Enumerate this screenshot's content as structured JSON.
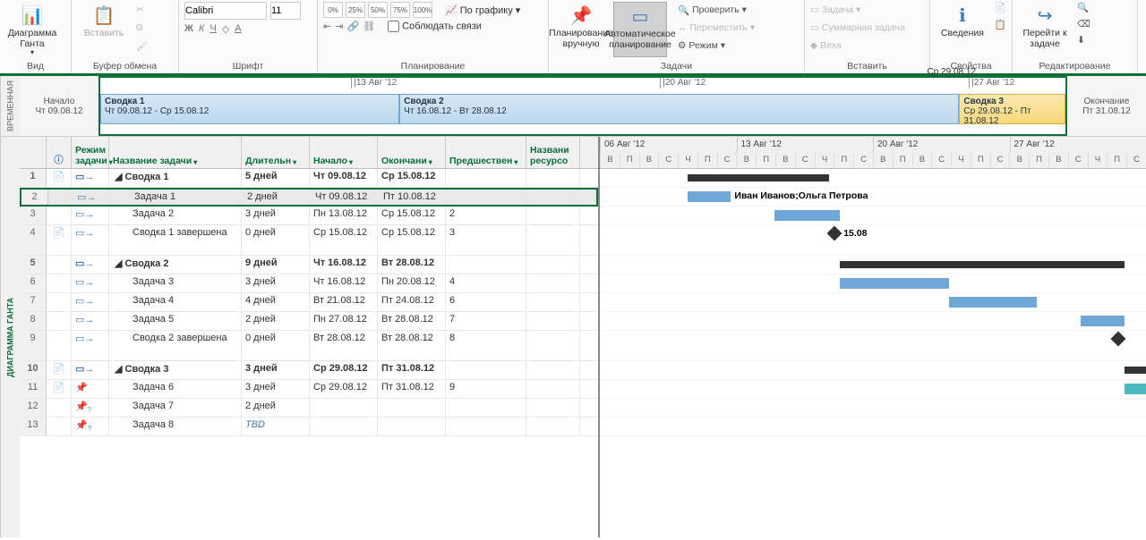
{
  "ribbon": {
    "groups": {
      "view": {
        "title": "Вид",
        "gantt_btn": "Диаграмма Ганта"
      },
      "clipboard": {
        "title": "Буфер обмена",
        "paste": "Вставить",
        "cut": "Вырезать",
        "copy": "Копировать",
        "fmt": "Формат по образцу"
      },
      "font": {
        "title": "Шрифт",
        "name": "Calibri",
        "size": "11"
      },
      "schedule": {
        "title": "Планирование",
        "links": "Соблюдать связи",
        "chart": "По графику",
        "pcts": [
          "0%",
          "25%",
          "50%",
          "75%",
          "100%"
        ]
      },
      "tasks": {
        "title": "Задачи",
        "manual": "Планирование вручную",
        "auto": "Автоматическое планирование",
        "inspect": "Проверить",
        "move": "Переместить",
        "mode": "Режим"
      },
      "insert": {
        "title": "Вставить",
        "task": "Задача",
        "sum": "Суммарная задача",
        "milestone": "Веха"
      },
      "props": {
        "title": "Свойства",
        "info": "Сведения"
      },
      "edit": {
        "title": "Редактирование",
        "goto": "Перейти к задаче"
      }
    }
  },
  "timeline": {
    "side": "ВРЕМЕННАЯ",
    "start_label": "Начало",
    "start_date": "Чт 09.08.12",
    "end_label": "Окончание",
    "end_date": "Пт 31.08.12",
    "ticks": [
      {
        "pos": 26,
        "label": "13 Авг '12"
      },
      {
        "pos": 58,
        "label": "20 Авг '12"
      },
      {
        "pos": 90,
        "label": "27 Авг '12"
      }
    ],
    "current": "Ср 29.08.12",
    "bars": [
      {
        "title": "Сводка 1",
        "dates": "Чт 09.08.12 - Ср 15.08.12",
        "w": 31,
        "cls": ""
      },
      {
        "title": "Сводка 2",
        "dates": "Чт 16.08.12 - Вт 28.08.12",
        "w": 58,
        "cls": ""
      },
      {
        "title": "Сводка 3",
        "dates": "Ср 29.08.12 - Пт 31.08.12",
        "w": 11,
        "cls": "sv3"
      }
    ]
  },
  "table": {
    "side": "ДИАГРАММА ГАНТА",
    "headers": {
      "mode": "Режим задачи",
      "name": "Название задачи",
      "dur": "Длительн",
      "start": "Начало",
      "fin": "Окончани",
      "pred": "Предшествен",
      "res": "Названи ресурсо"
    },
    "rows": [
      {
        "n": 1,
        "i": "note",
        "mode": "auto",
        "name": "Сводка 1",
        "indent": 0,
        "summary": true,
        "dur": "5 дней",
        "start": "Чт 09.08.12",
        "fin": "Ср 15.08.12",
        "pred": "",
        "bold": true
      },
      {
        "n": 2,
        "i": "",
        "mode": "auto",
        "name": "Задача 1",
        "indent": 1,
        "dur": "2 дней",
        "start": "Чт 09.08.12",
        "fin": "Пт 10.08.12",
        "pred": "",
        "sel": true
      },
      {
        "n": 3,
        "i": "",
        "mode": "auto",
        "name": "Задача 2",
        "indent": 1,
        "dur": "3 дней",
        "start": "Пн 13.08.12",
        "fin": "Ср 15.08.12",
        "pred": "2"
      },
      {
        "n": 4,
        "i": "note",
        "mode": "auto",
        "name": "Сводка 1 завершена",
        "indent": 1,
        "dur": "0 дней",
        "start": "Ср 15.08.12",
        "fin": "Ср 15.08.12",
        "pred": "3",
        "tall": true
      },
      {
        "n": 5,
        "i": "",
        "mode": "auto",
        "name": "Сводка 2",
        "indent": 0,
        "summary": true,
        "dur": "9 дней",
        "start": "Чт 16.08.12",
        "fin": "Вт 28.08.12",
        "pred": "",
        "bold": true
      },
      {
        "n": 6,
        "i": "",
        "mode": "auto",
        "name": "Задача 3",
        "indent": 1,
        "dur": "3 дней",
        "start": "Чт 16.08.12",
        "fin": "Пн 20.08.12",
        "pred": "4"
      },
      {
        "n": 7,
        "i": "",
        "mode": "auto",
        "name": "Задача 4",
        "indent": 1,
        "dur": "4 дней",
        "start": "Вт 21.08.12",
        "fin": "Пт 24.08.12",
        "pred": "6"
      },
      {
        "n": 8,
        "i": "",
        "mode": "auto",
        "name": "Задача 5",
        "indent": 1,
        "dur": "2 дней",
        "start": "Пн 27.08.12",
        "fin": "Вт 28.08.12",
        "pred": "7"
      },
      {
        "n": 9,
        "i": "",
        "mode": "auto",
        "name": "Сводка 2 завершена",
        "indent": 1,
        "dur": "0 дней",
        "start": "Вт 28.08.12",
        "fin": "Вт 28.08.12",
        "pred": "8",
        "tall": true
      },
      {
        "n": 10,
        "i": "note",
        "mode": "auto",
        "name": "Сводка 3",
        "indent": 0,
        "summary": true,
        "dur": "3 дней",
        "start": "Ср 29.08.12",
        "fin": "Пт 31.08.12",
        "pred": "",
        "bold": true
      },
      {
        "n": 11,
        "i": "note",
        "mode": "manual",
        "name": "Задача 6",
        "indent": 1,
        "dur": "3 дней",
        "start": "Ср 29.08.12",
        "fin": "Пт 31.08.12",
        "pred": "9"
      },
      {
        "n": 12,
        "i": "",
        "mode": "manual-q",
        "name": "Задача 7",
        "indent": 1,
        "dur": "2 дней",
        "start": "",
        "fin": "",
        "pred": ""
      },
      {
        "n": 13,
        "i": "",
        "mode": "manual-q",
        "name": "Задача 8",
        "indent": 1,
        "dur": "TBD",
        "start": "",
        "fin": "",
        "pred": "",
        "tbd": true
      }
    ]
  },
  "gantt": {
    "weeks": [
      "06 Авг '12",
      "13 Авг '12",
      "20 Авг '12",
      "27 Авг '12"
    ],
    "days": [
      "В",
      "П",
      "В",
      "С",
      "Ч",
      "П",
      "С"
    ],
    "bar1_label": "Иван Иванов;Ольга Петрова",
    "ms_label": "15.08"
  }
}
